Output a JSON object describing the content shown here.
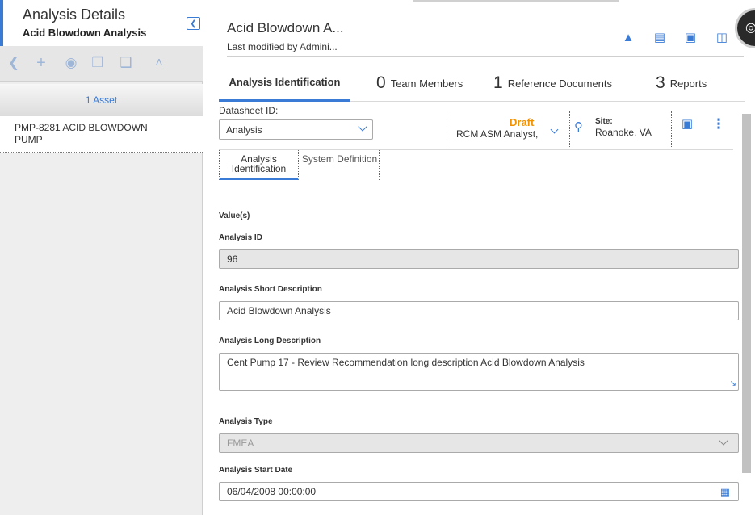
{
  "left": {
    "title": "Analysis Details",
    "subtitle": "Acid Blowdown Analysis",
    "toolbar": [
      "back",
      "add",
      "binoculars",
      "copy",
      "paste",
      "up"
    ],
    "asset_count": "1 Asset",
    "asset_item": "PMP-8281 ACID BLOWDOWN PUMP"
  },
  "record": {
    "title": "Acid Blowdown A...",
    "modified": "Last modified by Admini..."
  },
  "tabs": [
    {
      "num": "",
      "label": "Analysis Identification"
    },
    {
      "num": "0",
      "label": "Team Members"
    },
    {
      "num": "1",
      "label": "Reference Documents"
    },
    {
      "num": "3",
      "label": "Reports"
    }
  ],
  "datasheet": {
    "label": "Datasheet ID:",
    "value": "Analysis",
    "state": "Draft",
    "state_owner": "RCM ASM Analyst,",
    "site_label": "Site:",
    "site_value": "Roanoke, VA"
  },
  "subtabs": [
    {
      "label": "Analysis Identification"
    },
    {
      "label": "System Definition"
    }
  ],
  "form": {
    "section": "Value(s)",
    "analysis_id_label": "Analysis ID",
    "analysis_id": "96",
    "short_desc_label": "Analysis Short Description",
    "short_desc": "Acid Blowdown Analysis",
    "long_desc_label": "Analysis Long Description",
    "long_desc": "Cent Pump 17 - Review Recommendation long description Acid Blowdown Analysis",
    "type_label": "Analysis Type",
    "type": "FMEA",
    "start_label": "Analysis Start Date",
    "start": "06/04/2008 00:00:00"
  },
  "colors": {
    "accent": "#3a7bd5",
    "draft": "#f39200"
  }
}
